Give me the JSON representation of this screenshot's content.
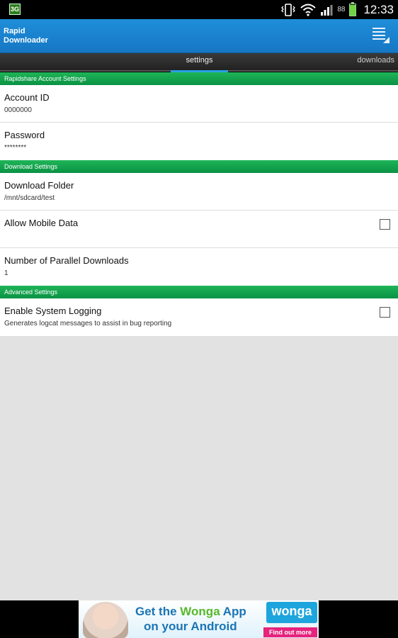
{
  "status_bar": {
    "network_label": "3G",
    "battery_level": "88",
    "battery_fill_percent": 88,
    "time": "12:33",
    "icons": [
      "vibrate-icon",
      "wifi-icon",
      "signal-icon",
      "battery-icon"
    ]
  },
  "action_bar": {
    "title_line1": "Rapid",
    "title_line2": "Downloader"
  },
  "tabs": [
    {
      "label": "settings",
      "selected": true
    },
    {
      "label": "downloads",
      "selected": false
    }
  ],
  "sections": {
    "account": {
      "header": "Rapidshare Account Settings",
      "account_id": {
        "title": "Account ID",
        "summary": "0000000"
      },
      "password": {
        "title": "Password",
        "summary": "********"
      }
    },
    "download": {
      "header": "Download Settings",
      "download_folder": {
        "title": "Download Folder",
        "summary": "/mnt/sdcard/test"
      },
      "allow_mobile_data": {
        "title": "Allow Mobile Data",
        "checked": false
      },
      "parallel_downloads": {
        "title": "Number of Parallel Downloads",
        "summary": "1"
      }
    },
    "advanced": {
      "header": "Advanced Settings",
      "system_logging": {
        "title": "Enable System Logging",
        "summary": "Generates logcat messages to assist in bug reporting",
        "checked": false
      }
    }
  },
  "ad": {
    "line1_prefix": "Get the ",
    "line1_highlight": "Wonga",
    "line1_suffix": " App",
    "line2": "on your Android",
    "brand": "wonga",
    "cta": "Find out more"
  },
  "colors": {
    "action_bar": "#1f8ed9",
    "section_header": "#1fb558",
    "tab_indicator": "#27a0e6",
    "background": "#e2e2e2"
  }
}
